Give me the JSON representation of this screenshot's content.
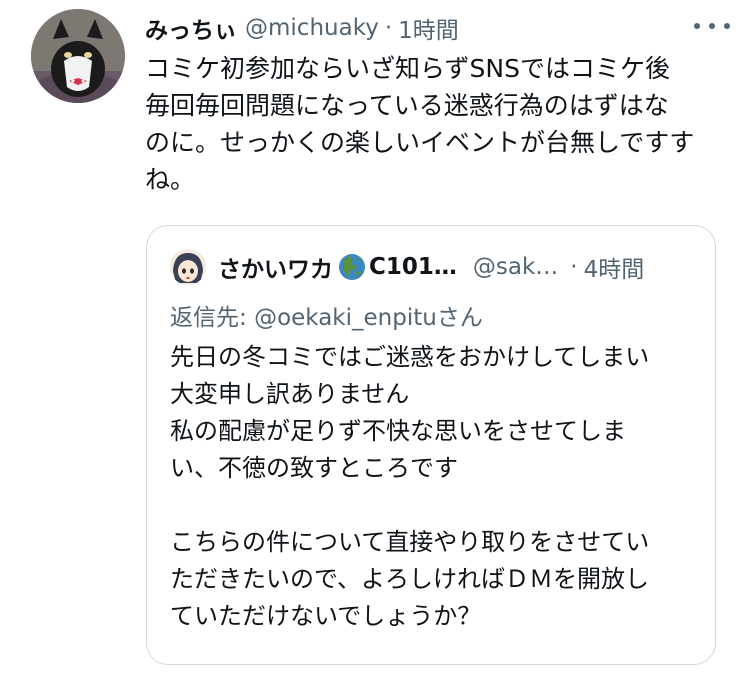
{
  "tweet": {
    "display_name": "みっちぃ",
    "handle": "@michuaky",
    "separator": "·",
    "time": "1時間",
    "more_icon": "more-dots-icon",
    "text_lines": [
      "コミケ初参加ならいざ知らずSNSではコミケ後",
      "毎回毎回問題になっている迷惑行為のはずはな",
      "のに。せっかくの楽しいイベントが台無しですす",
      "ね。"
    ]
  },
  "quoted": {
    "display_name": "さかいワカ",
    "name_icon": "globe-asia-emoji",
    "name_suffix": "C101…",
    "handle": "@sak…",
    "separator": "·",
    "time": "4時間",
    "reply_to_label": "返信先:",
    "reply_to_handle": "@oekaki_enpitu",
    "reply_to_suffix": "さん",
    "text_lines": [
      "先日の冬コミではご迷惑をおかけしてしまい",
      "大変申し訳ありません",
      "私の配慮が足りず不快な思いをさせてしま",
      "い、不徳の致すところです",
      "",
      "こちらの件について直接やり取りをさせてい",
      "ただきたいので、よろしければＤＭを開放し",
      "ていただけないでしょうか？"
    ]
  },
  "colors": {
    "text": "#0f1419",
    "secondary": "#536471",
    "link": "#1d9bf0",
    "border": "#cfd9de"
  }
}
